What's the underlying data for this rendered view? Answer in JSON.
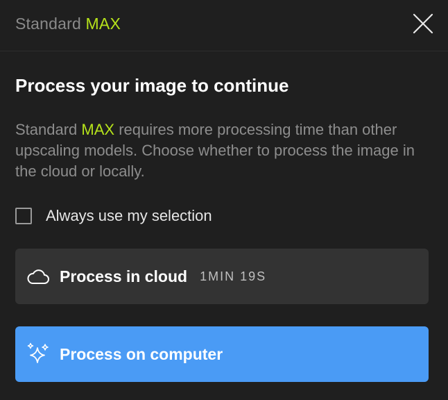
{
  "header": {
    "title_prefix": "Standard",
    "title_accent": "MAX"
  },
  "main": {
    "heading": "Process your image to continue",
    "description": {
      "prefix": "Standard",
      "accent": "MAX",
      "rest": "requires more processing time than other upscaling models. Choose whether to process the image in the cloud or locally."
    },
    "checkbox_label": "Always use my selection",
    "checkbox_checked": false
  },
  "options": {
    "cloud": {
      "label": "Process in cloud",
      "time": "1MIN 19S",
      "icon": "cloud-icon"
    },
    "computer": {
      "label": "Process on computer",
      "icon": "sparkles-icon"
    }
  },
  "colors": {
    "accent": "#b6e31b",
    "primary_button": "#4a9bf5",
    "secondary_button": "#333333",
    "background": "#1f1f1f"
  }
}
